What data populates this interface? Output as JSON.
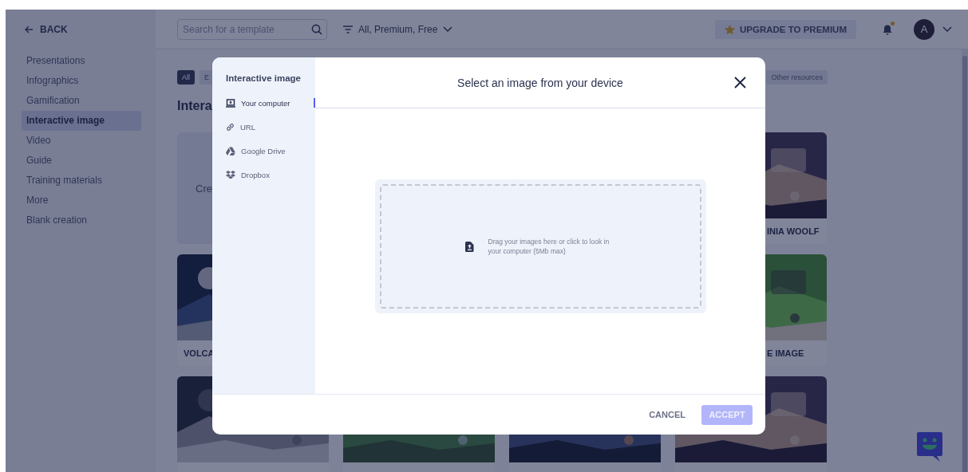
{
  "sidebar": {
    "back": "BACK",
    "items": [
      {
        "label": "Presentations",
        "selected": false
      },
      {
        "label": "Infographics",
        "selected": false
      },
      {
        "label": "Gamification",
        "selected": false
      },
      {
        "label": "Interactive image",
        "selected": true
      },
      {
        "label": "Video",
        "selected": false
      },
      {
        "label": "Guide",
        "selected": false
      },
      {
        "label": "Training materials",
        "selected": false
      },
      {
        "label": "More",
        "selected": false
      },
      {
        "label": "Blank creation",
        "selected": false
      }
    ]
  },
  "topbar": {
    "search": {
      "placeholder": "Search for a template"
    },
    "filter": "All, Premium, Free",
    "upgrade": "UPGRADE TO PREMIUM",
    "notification": true,
    "avatar": "A"
  },
  "content": {
    "chips": [
      {
        "label": "All",
        "selected": true
      },
      {
        "label": "E",
        "selected": false
      },
      {
        "label": "Other resources",
        "selected": false
      }
    ],
    "title": "Intera",
    "cards": [
      {
        "kind": "create",
        "label": "Cre"
      },
      {
        "kind": "template",
        "label": "INIA WOOLF"
      },
      {
        "kind": "template",
        "label": "VOLCA"
      },
      {
        "kind": "template",
        "label": "E IMAGE"
      },
      {
        "kind": "picture"
      },
      {
        "kind": "picture"
      },
      {
        "kind": "picture"
      },
      {
        "kind": "picture"
      }
    ]
  },
  "modal": {
    "sidebar_title": "Interactive image",
    "sources": [
      {
        "kind": "computer",
        "label": "Your computer",
        "selected": true
      },
      {
        "kind": "link",
        "label": "URL",
        "selected": false
      },
      {
        "kind": "drive",
        "label": "Google Drive",
        "selected": false
      },
      {
        "kind": "dropbox",
        "label": "Dropbox",
        "selected": false
      }
    ],
    "title": "Select an image from your device",
    "dropzone": "Drag your images here or click to look in your computer (5Mb max)",
    "cancel": "CANCEL",
    "accept": {
      "label": "ACCEPT",
      "disabled": true
    }
  }
}
